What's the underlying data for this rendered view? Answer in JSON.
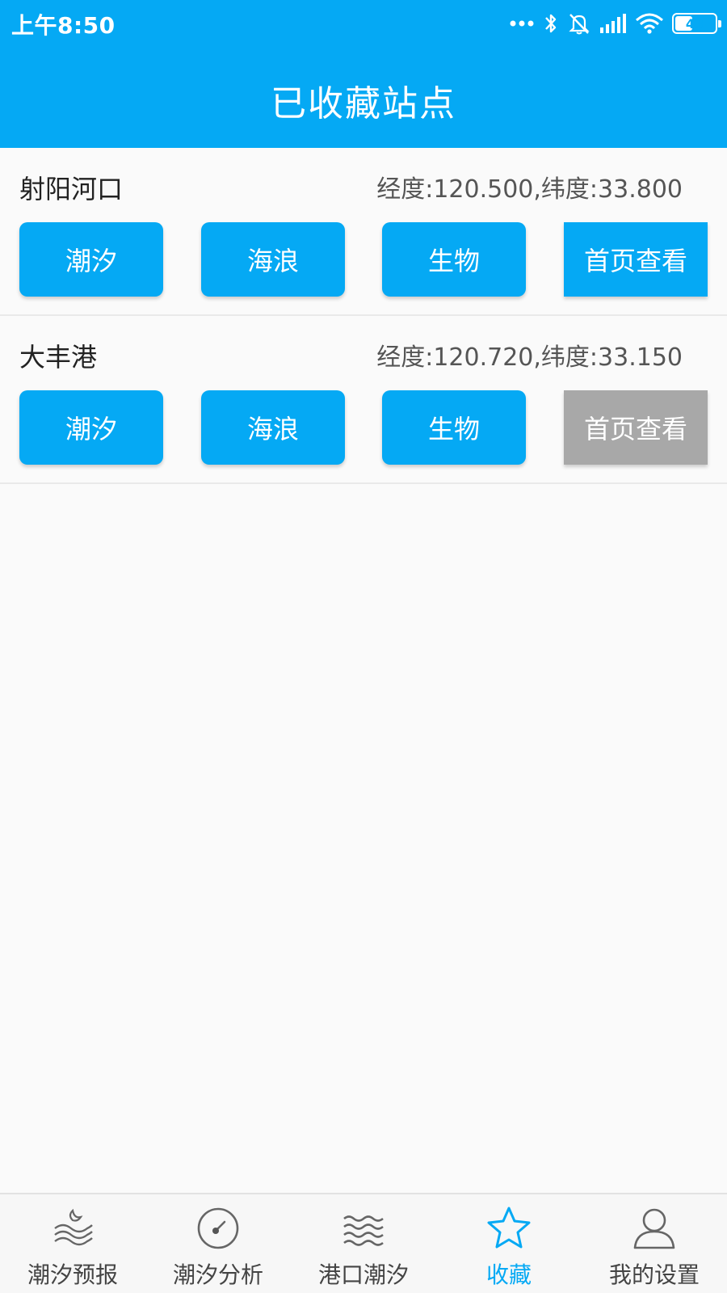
{
  "status_bar": {
    "time": "上午8:50",
    "battery_percent": 43,
    "battery_label": "43",
    "icons": [
      "more-dots-icon",
      "bluetooth-icon",
      "mute-icon",
      "signal-icon",
      "wifi-icon",
      "battery-icon"
    ]
  },
  "header": {
    "title": "已收藏站点"
  },
  "stations": [
    {
      "name": "射阳河口",
      "coords": "经度:120.500,纬度:33.800",
      "buttons": {
        "tide": "潮汐",
        "wave": "海浪",
        "bio": "生物",
        "home": "首页查看"
      },
      "home_enabled": true
    },
    {
      "name": "大丰港",
      "coords": "经度:120.720,纬度:33.150",
      "buttons": {
        "tide": "潮汐",
        "wave": "海浪",
        "bio": "生物",
        "home": "首页查看"
      },
      "home_enabled": false
    }
  ],
  "bottom_nav": {
    "items": [
      {
        "label": "潮汐预报",
        "icon": "tide-forecast-icon",
        "active": false
      },
      {
        "label": "潮汐分析",
        "icon": "gauge-icon",
        "active": false
      },
      {
        "label": "港口潮汐",
        "icon": "waves-icon",
        "active": false
      },
      {
        "label": "收藏",
        "icon": "star-icon",
        "active": true
      },
      {
        "label": "我的设置",
        "icon": "user-icon",
        "active": false
      }
    ]
  },
  "colors": {
    "primary": "#05a9f4",
    "disabled": "#a8a8a8",
    "nav_inactive": "#444444",
    "background": "#fafafa"
  }
}
